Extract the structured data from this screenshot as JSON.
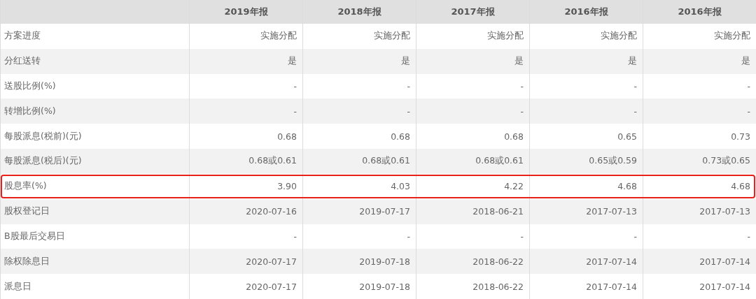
{
  "table": {
    "columns": [
      "2019年报",
      "2018年报",
      "2017年报",
      "2016年报",
      "2016年报"
    ],
    "rows": [
      {
        "label": "方案进度",
        "values": [
          "实施分配",
          "实施分配",
          "实施分配",
          "实施分配",
          "实施分配"
        ],
        "highlighted": false
      },
      {
        "label": "分红送转",
        "values": [
          "是",
          "是",
          "是",
          "是",
          "是"
        ],
        "highlighted": false
      },
      {
        "label": "送股比例(%)",
        "values": [
          "-",
          "-",
          "-",
          "-",
          "-"
        ],
        "highlighted": false
      },
      {
        "label": "转增比例(%)",
        "values": [
          "-",
          "-",
          "-",
          "-",
          "-"
        ],
        "highlighted": false
      },
      {
        "label": "每股派息(税前)(元)",
        "values": [
          "0.68",
          "0.68",
          "0.68",
          "0.65",
          "0.73"
        ],
        "highlighted": false
      },
      {
        "label": "每股派息(税后)(元)",
        "values": [
          "0.68或0.61",
          "0.68或0.61",
          "0.68或0.61",
          "0.65或0.59",
          "0.73或0.65"
        ],
        "highlighted": false
      },
      {
        "label": "股息率(%)",
        "values": [
          "3.90",
          "4.03",
          "4.22",
          "4.68",
          "4.68"
        ],
        "highlighted": true
      },
      {
        "label": "股权登记日",
        "values": [
          "2020-07-16",
          "2019-07-17",
          "2018-06-21",
          "2017-07-13",
          "2017-07-13"
        ],
        "highlighted": false
      },
      {
        "label": "B股最后交易日",
        "values": [
          "-",
          "-",
          "-",
          "-",
          "-"
        ],
        "highlighted": false
      },
      {
        "label": "除权除息日",
        "values": [
          "2020-07-17",
          "2019-07-18",
          "2018-06-22",
          "2017-07-14",
          "2017-07-14"
        ],
        "highlighted": false
      },
      {
        "label": "派息日",
        "values": [
          "2020-07-17",
          "2019-07-18",
          "2018-06-22",
          "2017-07-14",
          "2017-07-14"
        ],
        "highlighted": false
      }
    ]
  }
}
